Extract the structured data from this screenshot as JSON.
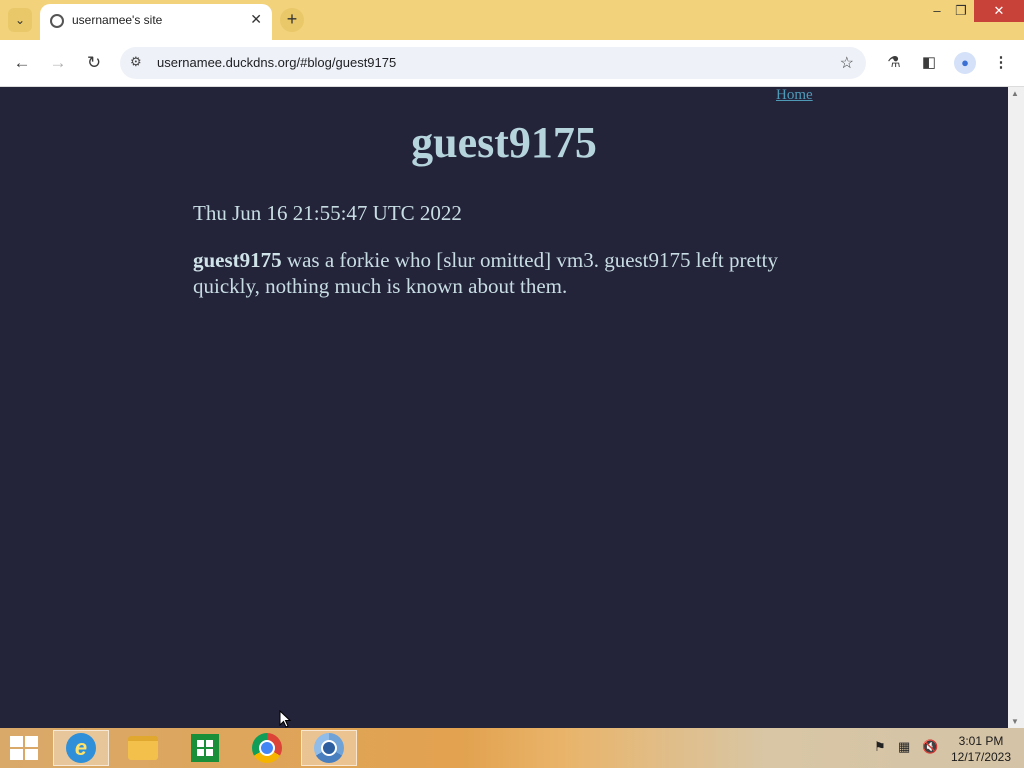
{
  "browser": {
    "tab": {
      "title": "usernamee's site"
    },
    "new_tab_symbol": "+",
    "address": {
      "url": "usernamee.duckdns.org/#blog/guest9175"
    },
    "window_controls": {
      "minimize": "–",
      "maximize": "❐",
      "close": "✕"
    }
  },
  "page": {
    "home_link": "Home",
    "title": "guest9175",
    "date": "Thu Jun 16 21:55:47 UTC 2022",
    "body_bold": "guest9175",
    "body_text": " was a forkie who [slur omitted] vm3. guest9175 left pretty quickly, nothing much is known about them."
  },
  "colors": {
    "page_background": "#23233a",
    "title_text": "#b6d4dc",
    "link": "#4f9ab7",
    "tabstrip": "#f2d27a"
  },
  "taskbar": {
    "apps": [
      {
        "name": "internet-explorer-icon"
      },
      {
        "name": "file-explorer-icon"
      },
      {
        "name": "store-icon"
      },
      {
        "name": "chrome-icon"
      },
      {
        "name": "chromium-icon"
      }
    ],
    "clock": {
      "time": "3:01 PM",
      "date": "12/17/2023"
    }
  }
}
